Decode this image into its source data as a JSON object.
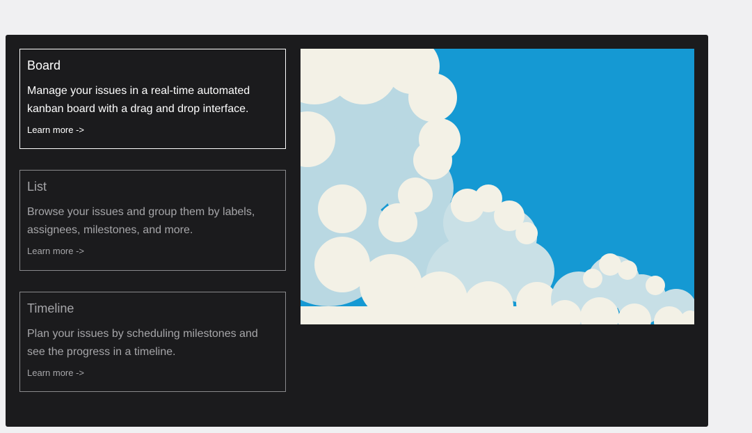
{
  "cards": [
    {
      "title": "Board",
      "description": "Manage your issues in a real-time automated kanban board with a drag and drop interface.",
      "link": "Learn more ->"
    },
    {
      "title": "List",
      "description": "Browse your issues and group them by labels, assignees, milestones, and more.",
      "link": "Learn more ->"
    },
    {
      "title": "Timeline",
      "description": "Plan your issues by scheduling milestones and see the progress in a timeline.",
      "link": "Learn more ->"
    }
  ],
  "colors": {
    "panel_bg": "#1b1b1d",
    "page_bg": "#f0f0f2",
    "sky": "#1599d3",
    "cloud": "#f3f1e6",
    "cloud_shadow": "#b7d6e0"
  },
  "illustration": {
    "subject": "sky-with-clouds"
  }
}
